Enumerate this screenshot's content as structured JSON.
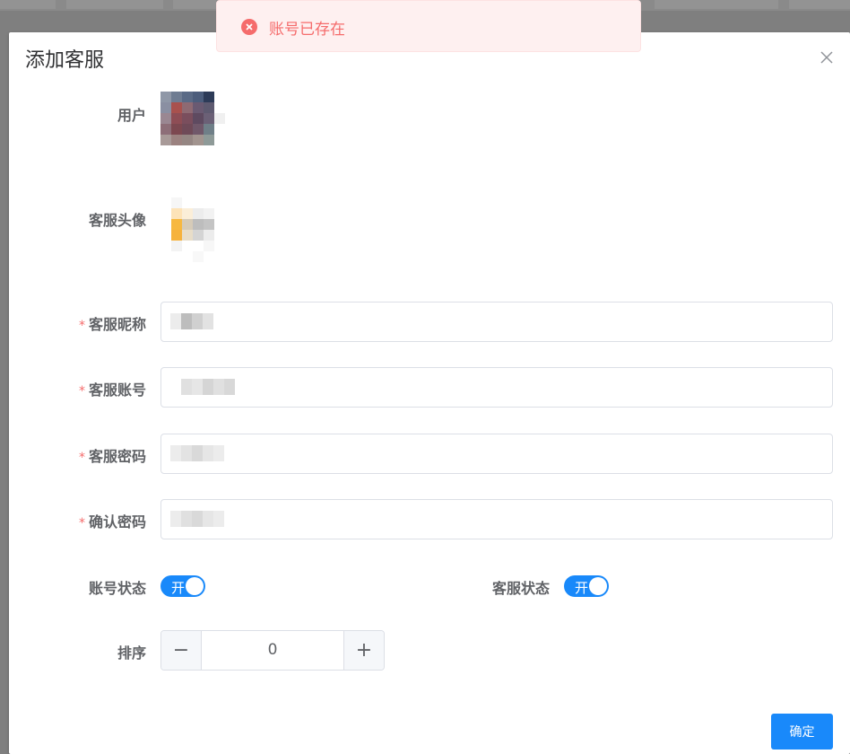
{
  "toast": {
    "message": "账号已存在",
    "icon": "error-circle-icon",
    "color": "#f56c6c"
  },
  "dialog": {
    "title": "添加客服",
    "close_icon": "close-icon"
  },
  "form": {
    "user_label": "用户",
    "avatar_label": "客服头像",
    "nickname_label": "客服昵称",
    "account_label": "客服账号",
    "password_label": "客服密码",
    "confirm_password_label": "确认密码",
    "required_mark": "*",
    "account_status_label": "账号状态",
    "account_status_value": "开",
    "service_status_label": "客服状态",
    "service_status_value": "开",
    "sort_label": "排序",
    "sort_value": "0",
    "minus": "−",
    "plus": "+"
  },
  "footer": {
    "confirm_label": "确定"
  },
  "colors": {
    "primary": "#1989fa",
    "danger": "#f56c6c",
    "border": "#dcdfe6"
  }
}
